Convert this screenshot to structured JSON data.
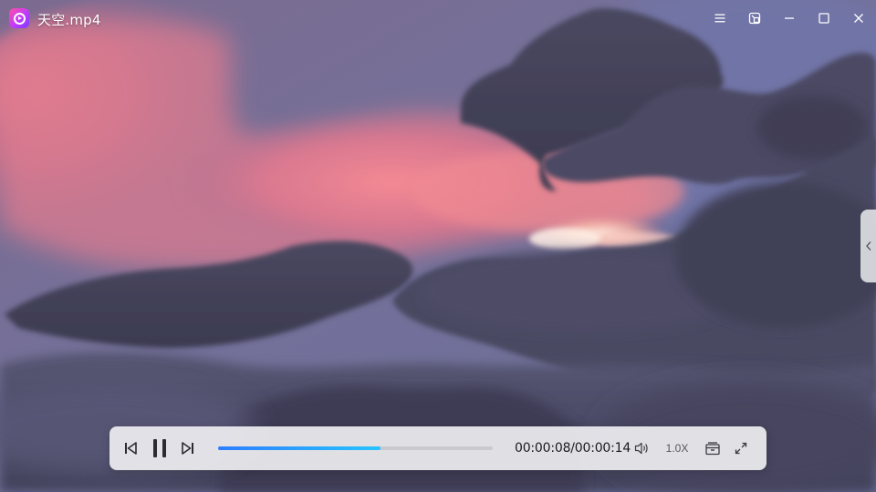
{
  "window": {
    "title": "天空.mp4",
    "app_icon": "movie-player-icon"
  },
  "titlebar_buttons": [
    {
      "name": "menu-button",
      "icon": "hamburger-menu-icon"
    },
    {
      "name": "mini-mode-button",
      "icon": "mini-mode-icon"
    },
    {
      "name": "minimize-button",
      "icon": "minimize-icon"
    },
    {
      "name": "maximize-button",
      "icon": "maximize-icon"
    },
    {
      "name": "close-button",
      "icon": "close-icon"
    }
  ],
  "side_panel": {
    "icon": "chevron-left-icon"
  },
  "player": {
    "current_time": "00:00:08",
    "duration": "00:00:14",
    "time_display": "00:00:08/00:00:14",
    "progress_fraction": 0.59,
    "state": "playing",
    "speed_label": "1.0X"
  },
  "colors": {
    "progress_start": "#2f7dff",
    "progress_end": "#27c4ff",
    "control_bar_bg": "#eeeef1"
  }
}
